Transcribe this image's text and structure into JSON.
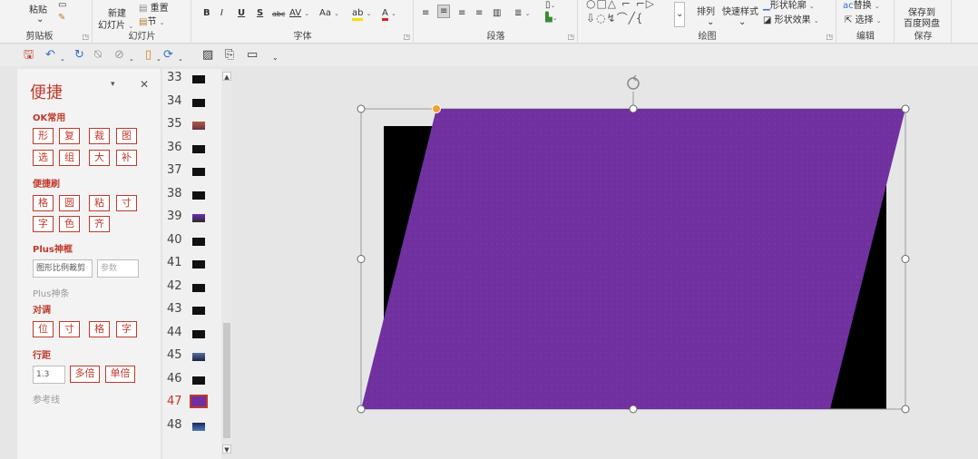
{
  "ribbon": {
    "clipboard": {
      "paste": "粘贴",
      "label": "剪贴板"
    },
    "slides": {
      "new_line1": "新建",
      "new_line2": "幻灯片",
      "reset": "重置",
      "section": "节",
      "label": "幻灯片"
    },
    "font": {
      "bold": "B",
      "italic": "I",
      "underline": "U",
      "shadow": "S",
      "strike": "abc",
      "spacing": "AV",
      "case": "Aa",
      "label": "字体"
    },
    "paragraph": {
      "label": "段落"
    },
    "drawing": {
      "arrange": "排列",
      "quick_styles": "快速样式",
      "outline": "形状轮廓",
      "effects": "形状效果",
      "label": "绘图"
    },
    "editing": {
      "replace": "替换",
      "select": "选择",
      "label": "编辑"
    },
    "save": {
      "line1": "保存到",
      "line2": "百度网盘",
      "label": "保存"
    }
  },
  "panel": {
    "title": "便捷",
    "sections": {
      "ok_common": "OK常用",
      "brush": "便捷刷",
      "plus_frame": "Plus神框",
      "plus_strip": "Plus神条",
      "align": "对调",
      "line_spacing": "行距",
      "guides": "参考线"
    },
    "ok_buttons": [
      "形",
      "复",
      "裁",
      "图",
      "选",
      "组",
      "大",
      "补"
    ],
    "brush_buttons": [
      "格",
      "圆",
      "粘",
      "寸",
      "字",
      "色",
      "齐"
    ],
    "plus_frame": {
      "value": "图形比例裁剪",
      "placeholder": "参数"
    },
    "align_buttons": [
      "位",
      "寸",
      "格",
      "字"
    ],
    "line_spacing": {
      "value": "1.3",
      "multi": "多倍",
      "single": "单倍"
    }
  },
  "slides": [
    {
      "num": "33",
      "style": ""
    },
    {
      "num": "34",
      "style": ""
    },
    {
      "num": "35",
      "style": "c35"
    },
    {
      "num": "36",
      "style": ""
    },
    {
      "num": "37",
      "style": ""
    },
    {
      "num": "38",
      "style": ""
    },
    {
      "num": "39",
      "style": "c39"
    },
    {
      "num": "40",
      "style": ""
    },
    {
      "num": "41",
      "style": ""
    },
    {
      "num": "42",
      "style": ""
    },
    {
      "num": "43",
      "style": ""
    },
    {
      "num": "44",
      "style": ""
    },
    {
      "num": "45",
      "style": "c45"
    },
    {
      "num": "46",
      "style": ""
    },
    {
      "num": "47",
      "style": "active"
    },
    {
      "num": "48",
      "style": "c48"
    }
  ],
  "colors": {
    "accent_red": "#c0392b",
    "shape_fill": "#7030a0",
    "rect_fill": "#000000",
    "handle_yellow": "#f0a030"
  },
  "icons": [
    "save-icon",
    "undo-icon",
    "redo-icon",
    "rotate-handle-icon"
  ]
}
